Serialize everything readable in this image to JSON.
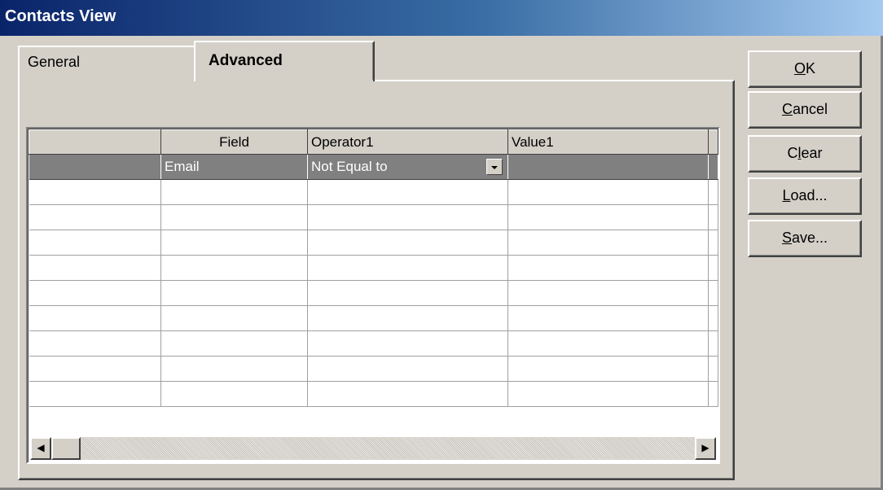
{
  "window": {
    "title": "Contacts View"
  },
  "tabs": [
    {
      "label": "General",
      "active": false
    },
    {
      "label": "Advanced",
      "active": true
    }
  ],
  "grid": {
    "columns": [
      "",
      "Field",
      "Operator1",
      "Value1"
    ],
    "rows": [
      {
        "index": "",
        "field": "Email",
        "operator": "Not Equal to",
        "value": "",
        "selected": true
      }
    ],
    "empty_row_count": 9
  },
  "buttons": {
    "ok": {
      "mnemonic": "O",
      "rest": "K"
    },
    "cancel": {
      "mnemonic": "C",
      "rest": "ancel"
    },
    "clear": {
      "pre": "C",
      "mnemonic": "l",
      "rest": "ear"
    },
    "load": {
      "mnemonic": "L",
      "rest": "oad..."
    },
    "save": {
      "mnemonic": "S",
      "rest": "ave..."
    }
  },
  "icons": {
    "dropdown": "chevron-down-icon",
    "scroll_left": "arrow-left-icon",
    "scroll_right": "arrow-right-icon"
  },
  "colors": {
    "titlebar_start": "#0a246a",
    "titlebar_end": "#a6caf0",
    "face": "#d4d0c8",
    "selected_row": "#808080"
  }
}
